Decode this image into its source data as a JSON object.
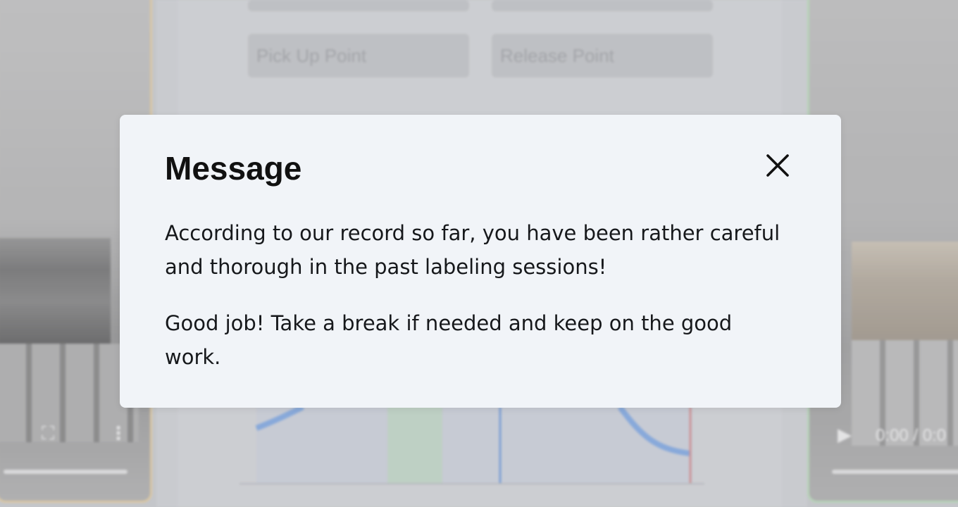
{
  "background": {
    "fields": {
      "pick_up_point": "Pick Up Point",
      "release_point": "Release Point"
    },
    "right_video": {
      "time": "0:00 / 0:0"
    }
  },
  "modal": {
    "title": "Message",
    "paragraphs": [
      "According to our record so far, you have been rather careful and thorough in the past labeling sessions!",
      "Good job! Take a break if needed and keep on the good work."
    ],
    "close_icon": "close-icon"
  },
  "colors": {
    "modal_bg": "#f1f4f8",
    "text": "#111111",
    "left_video_border": "#e8d2a8",
    "right_video_border": "#bfe0bf"
  }
}
